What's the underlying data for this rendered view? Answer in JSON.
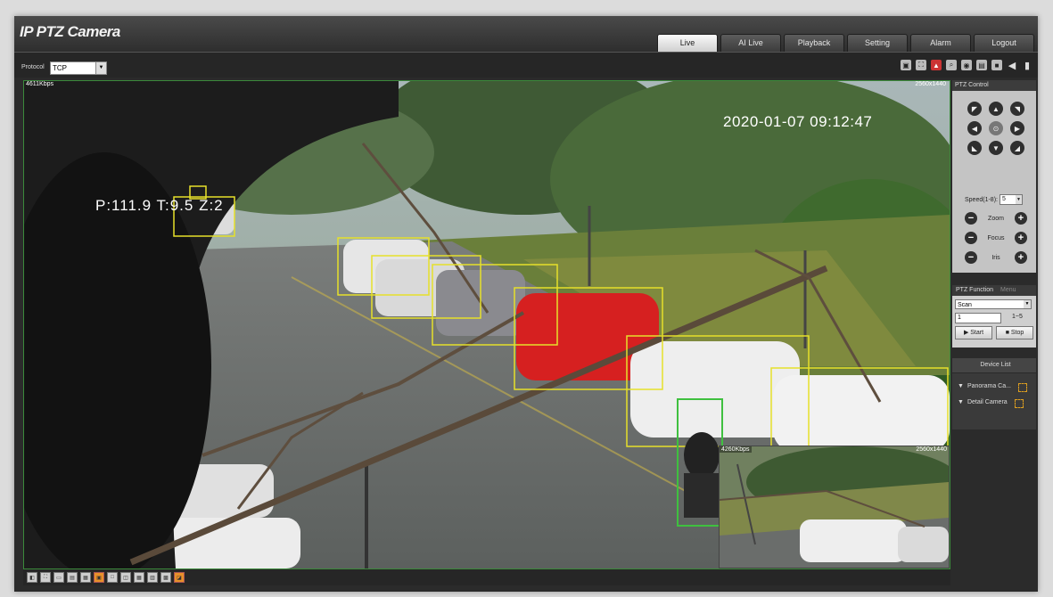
{
  "app": {
    "title": "IP PTZ Camera"
  },
  "nav": {
    "tabs": [
      "Live",
      "AI Live",
      "Playback",
      "Setting",
      "Alarm",
      "Logout"
    ],
    "active_index": 0
  },
  "toolbar": {
    "protocol_label": "Protocol",
    "protocol_value": "TCP",
    "icons": [
      "video-wall-icon",
      "fullscreen-icon",
      "alarm-icon",
      "zoom-icon",
      "snapshot-icon",
      "triple-snapshot-icon",
      "record-icon",
      "audio-icon",
      "microphone-icon"
    ]
  },
  "video": {
    "bitrate": "4611Kbps",
    "resolution": "2560x1440",
    "timestamp": "2020-01-07 09:12:47",
    "ptz_position": "P:111.9 T:9.5 Z:2"
  },
  "pip": {
    "bitrate": "4260Kbps",
    "resolution": "2560x1440"
  },
  "ptz_control": {
    "title": "PTZ Control",
    "speed_label": "Speed(1-8):",
    "speed_value": "5",
    "zoom_label": "Zoom",
    "focus_label": "Focus",
    "iris_label": "Iris"
  },
  "ptz_function": {
    "tab_function": "PTZ Function",
    "tab_menu": "Menu",
    "mode_value": "Scan",
    "number_value": "1",
    "range": "1~5",
    "start_label": "Start",
    "stop_label": "Stop"
  },
  "device_list": {
    "title": "Device List",
    "items": [
      "Panorama Ca...",
      "Detail Camera"
    ]
  },
  "colors": {
    "accent": "#e8902a",
    "detection_box": "#e6e02a",
    "border_green": "#3b8a3b"
  }
}
